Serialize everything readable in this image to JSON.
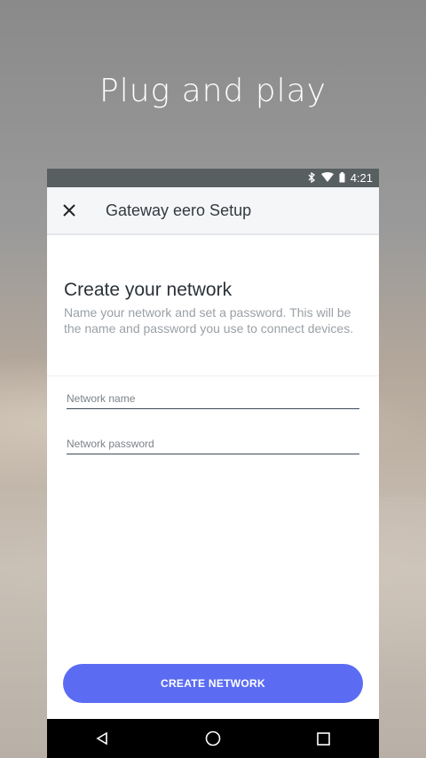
{
  "headline": "Plug and play",
  "status_bar": {
    "time": "4:21",
    "icons": [
      "bluetooth-icon",
      "wifi-icon",
      "battery-icon"
    ]
  },
  "app_bar": {
    "close_icon": "close-icon",
    "title": "Gateway eero Setup"
  },
  "form": {
    "title": "Create your network",
    "description": "Name your network and set a password. This will be the name and password you use to connect devices.",
    "network_name": {
      "value": "",
      "placeholder": "Network name"
    },
    "network_password": {
      "value": "",
      "placeholder": "Network password"
    },
    "submit_label": "CREATE NETWORK"
  },
  "nav_bar": {
    "buttons": [
      "back-icon",
      "home-icon",
      "recents-icon"
    ]
  },
  "colors": {
    "accent": "#5b6cf3",
    "status_bar": "#575f60",
    "nav_bar": "#000000"
  }
}
